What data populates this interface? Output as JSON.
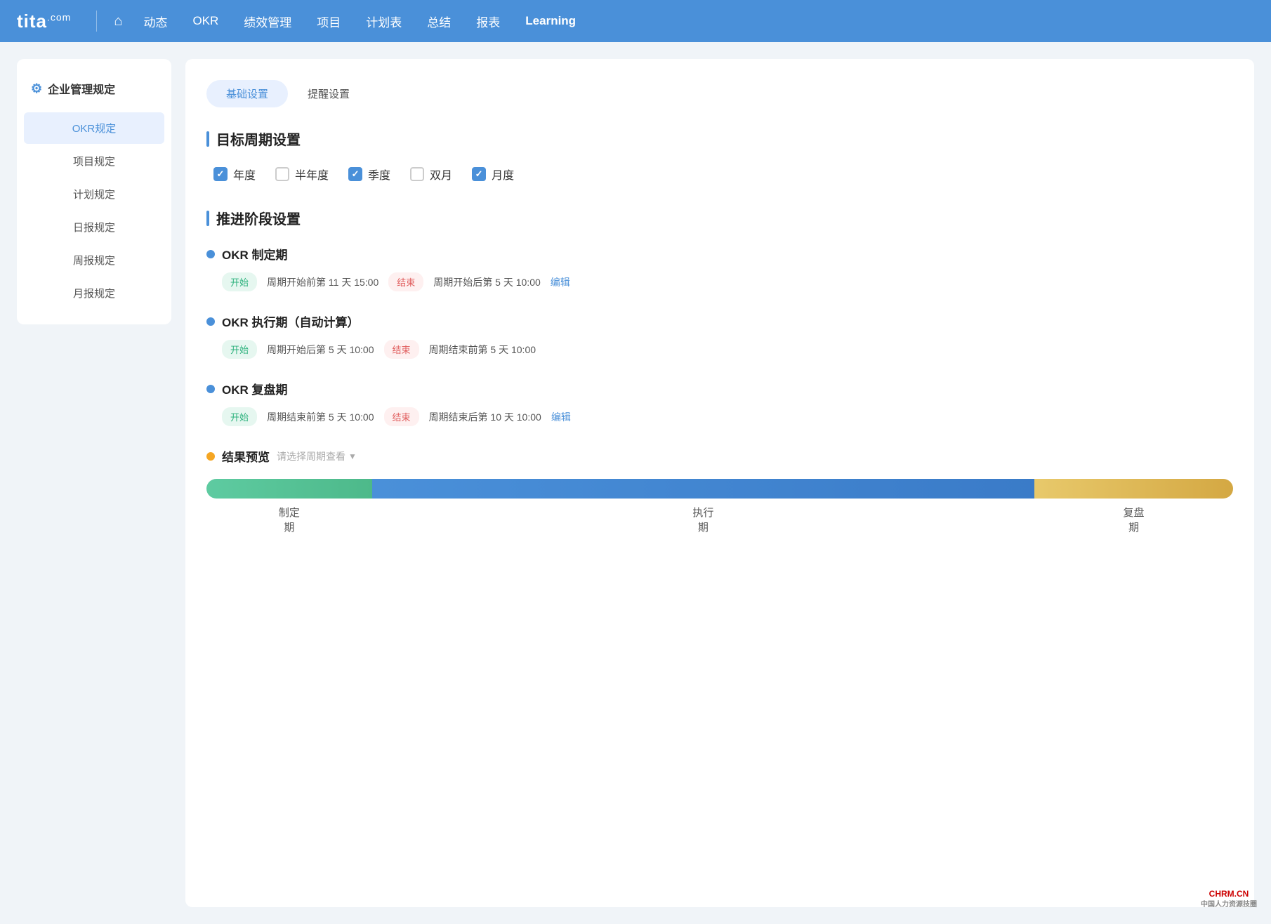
{
  "nav": {
    "logo": "tita",
    "logo_com": ".com",
    "items": [
      {
        "label": "动态",
        "active": false
      },
      {
        "label": "OKR",
        "active": false
      },
      {
        "label": "绩效管理",
        "active": false
      },
      {
        "label": "项目",
        "active": false
      },
      {
        "label": "计划表",
        "active": false
      },
      {
        "label": "总结",
        "active": false
      },
      {
        "label": "报表",
        "active": false
      },
      {
        "label": "Learning",
        "active": true,
        "special": true
      }
    ]
  },
  "sidebar": {
    "header": "企业管理规定",
    "items": [
      {
        "label": "OKR规定",
        "active": true
      },
      {
        "label": "项目规定",
        "active": false
      },
      {
        "label": "计划规定",
        "active": false
      },
      {
        "label": "日报规定",
        "active": false
      },
      {
        "label": "周报规定",
        "active": false
      },
      {
        "label": "月报规定",
        "active": false
      }
    ]
  },
  "tabs": [
    {
      "label": "基础设置",
      "active": true
    },
    {
      "label": "提醒设置",
      "active": false
    }
  ],
  "cycle_section": {
    "title": "目标周期设置",
    "checkboxes": [
      {
        "label": "年度",
        "checked": true
      },
      {
        "label": "半年度",
        "checked": false
      },
      {
        "label": "季度",
        "checked": true
      },
      {
        "label": "双月",
        "checked": false
      },
      {
        "label": "月度",
        "checked": true
      }
    ]
  },
  "phase_section": {
    "title": "推进阶段设置",
    "phases": [
      {
        "title": "OKR 制定期",
        "dot_color": "#4a90d9",
        "start_badge": "开始",
        "start_text": "周期开始前第 11 天 15:00",
        "end_badge": "结束",
        "end_text": "周期开始后第 5 天 10:00",
        "editable": true,
        "edit_label": "编辑"
      },
      {
        "title": "OKR 执行期（自动计算）",
        "dot_color": "#4a90d9",
        "start_badge": "开始",
        "start_text": "周期开始后第 5 天 10:00",
        "end_badge": "结束",
        "end_text": "周期结束前第 5 天 10:00",
        "editable": false,
        "edit_label": ""
      },
      {
        "title": "OKR 复盘期",
        "dot_color": "#4a90d9",
        "start_badge": "开始",
        "start_text": "周期结束前第 5 天 10:00",
        "end_badge": "结束",
        "end_text": "周期结束后第 10 天 10:00",
        "editable": true,
        "edit_label": "编辑"
      }
    ]
  },
  "result_preview": {
    "label": "结果预览",
    "select_placeholder": "请选择周期查看",
    "dot_color": "#f5a623"
  },
  "progress_bar": {
    "segments": [
      {
        "label": "制定\n期",
        "label_line1": "制定",
        "label_line2": "期"
      },
      {
        "label": "执行\n期",
        "label_line1": "执行",
        "label_line2": "期"
      },
      {
        "label": "复盘\n期",
        "label_line1": "复盘",
        "label_line2": "期"
      }
    ]
  },
  "watermark": {
    "line1": "CHRM.CN",
    "line2": "中国人力资源技圈"
  }
}
